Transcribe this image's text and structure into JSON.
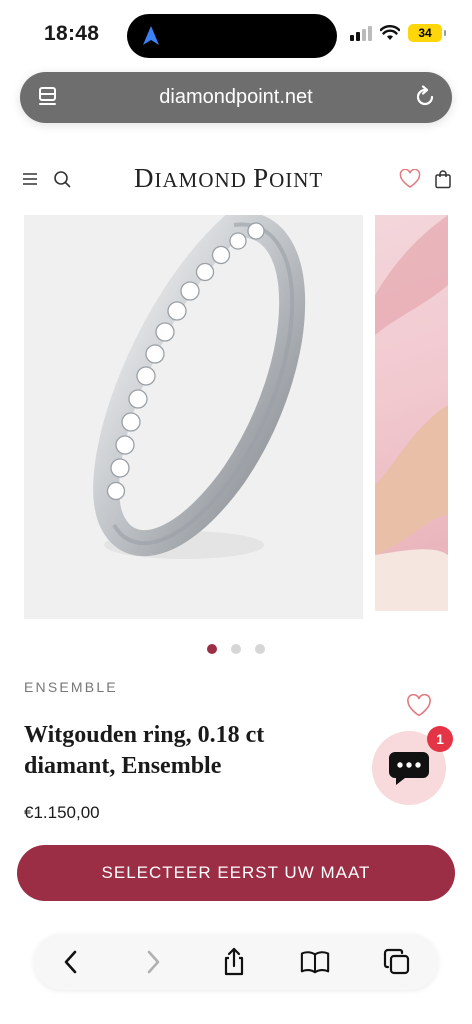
{
  "status": {
    "time": "18:48",
    "battery": "34"
  },
  "browser": {
    "url": "diamondpoint.net"
  },
  "site": {
    "logo_first": "D",
    "logo_rest1": "IAMOND ",
    "logo_second": "P",
    "logo_rest2": "OINT"
  },
  "gallery": {
    "slide_count": 3,
    "active_index": 0
  },
  "product": {
    "brand": "ENSEMBLE",
    "title": "Witgouden ring, 0.18 ct diamant, Ensemble",
    "price": "€1.150,00",
    "cta_label": "SELECTEER EERST UW MAAT"
  },
  "chat": {
    "badge_count": "1"
  },
  "colors": {
    "accent": "#9b2d45",
    "badge": "#e33545",
    "chat_bg": "#f8d9dc",
    "heart": "#e07c80"
  },
  "icons": [
    "navigation-arrow-icon",
    "signal-icon",
    "wifi-icon",
    "tabs-overview-icon",
    "reload-icon",
    "menu-icon",
    "search-icon",
    "heart-icon",
    "bag-icon",
    "chat-icon",
    "back-icon",
    "forward-icon",
    "share-icon",
    "bookmarks-icon",
    "tabs-icon"
  ]
}
